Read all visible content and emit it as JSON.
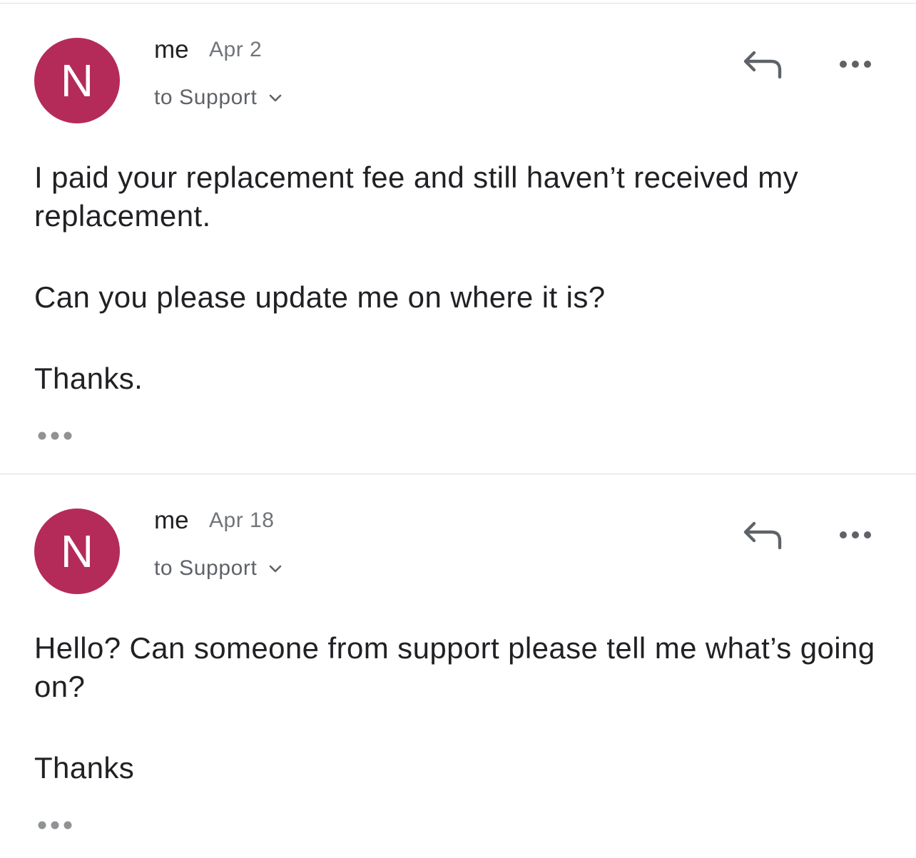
{
  "colors": {
    "avatar_bg": "#b42b59",
    "icon_gray": "#5f6368",
    "dots_gray": "#8f9396"
  },
  "icons": {
    "reply": "reply-arrow-icon",
    "more": "three-dots-horizontal-icon",
    "chevron": "chevron-down-icon",
    "trimmed": "show-trimmed-content-dots-icon"
  },
  "messages": [
    {
      "avatar_letter": "N",
      "sender": "me",
      "date": "Apr 2",
      "recipient": "to Support",
      "paragraphs": [
        "I paid your replacement fee and still haven’t received my replacement.",
        "Can you please update me on where it is?",
        "Thanks."
      ]
    },
    {
      "avatar_letter": "N",
      "sender": "me",
      "date": "Apr 18",
      "recipient": "to Support",
      "paragraphs": [
        "Hello? Can someone from support please tell me what’s going on?",
        "Thanks"
      ]
    }
  ]
}
